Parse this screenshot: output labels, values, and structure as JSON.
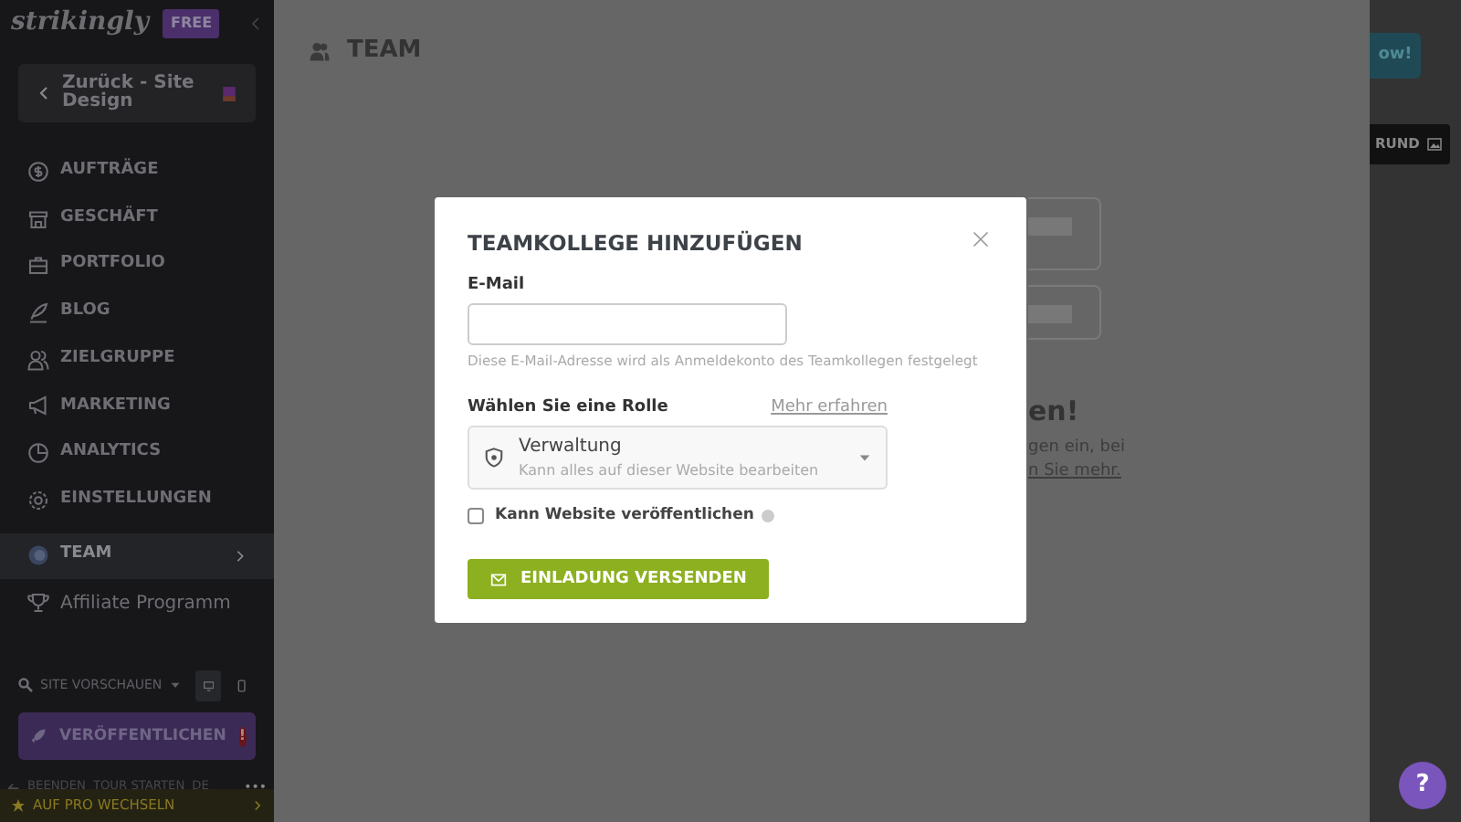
{
  "sidebar": {
    "logo": "strikingly",
    "plan_badge": "FREE",
    "back_link": "Zurück - Site Design",
    "items": [
      {
        "label": "AUFTRÄGE",
        "kind": "nav",
        "selected": false
      },
      {
        "label": "GESCHÄFT",
        "kind": "nav",
        "selected": false
      },
      {
        "label": "PORTFOLIO",
        "kind": "nav",
        "selected": false
      },
      {
        "label": "BLOG",
        "kind": "nav",
        "selected": false
      },
      {
        "label": "ZIELGRUPPE",
        "kind": "nav",
        "selected": false
      },
      {
        "label": "MARKETING",
        "kind": "nav",
        "selected": false
      },
      {
        "label": "ANALYTICS",
        "kind": "nav",
        "selected": false
      },
      {
        "label": "EINSTELLUNGEN",
        "kind": "nav",
        "selected": false
      },
      {
        "label": "TEAM",
        "kind": "nav",
        "selected": true
      },
      {
        "label": "Affiliate Programm",
        "kind": "plain",
        "selected": false
      }
    ],
    "preview": "SITE VORSCHAUEN",
    "devices": [
      {
        "kind": "desktop",
        "selected": true
      },
      {
        "kind": "mobile",
        "selected": false
      }
    ],
    "publish": {
      "label": "VERÖFFENTLICHEN",
      "alert": "!"
    },
    "footer_links": [
      "BEENDEN",
      "TOUR STARTEN",
      "DE"
    ],
    "more": "•••",
    "upgrade": "AUF PRO WECHSELN"
  },
  "page": {
    "title": "TEAM",
    "background_fragments": {
      "heading": "en!",
      "text": "gen ein, bei",
      "link": "n Sie mehr."
    },
    "top_button": "ow!",
    "dark_button": "RUND"
  },
  "modal": {
    "title": "TEAMKOLLEGE HINZUFÜGEN",
    "email_label": "E-Mail",
    "email_hint": "Diese E-Mail-Adresse wird als Anmeldekonto des Teamkollegen festgelegt",
    "role_label": "Wählen Sie eine Rolle",
    "learn_more": "Mehr erfahren",
    "role": {
      "title": "Verwaltung",
      "description": "Kann alles auf dieser Website bearbeiten"
    },
    "checkbox": {
      "label": "Kann Website veröffentlichen",
      "checked": false
    },
    "submit": "EINLADUNG VERSENDEN"
  },
  "help": "?"
}
